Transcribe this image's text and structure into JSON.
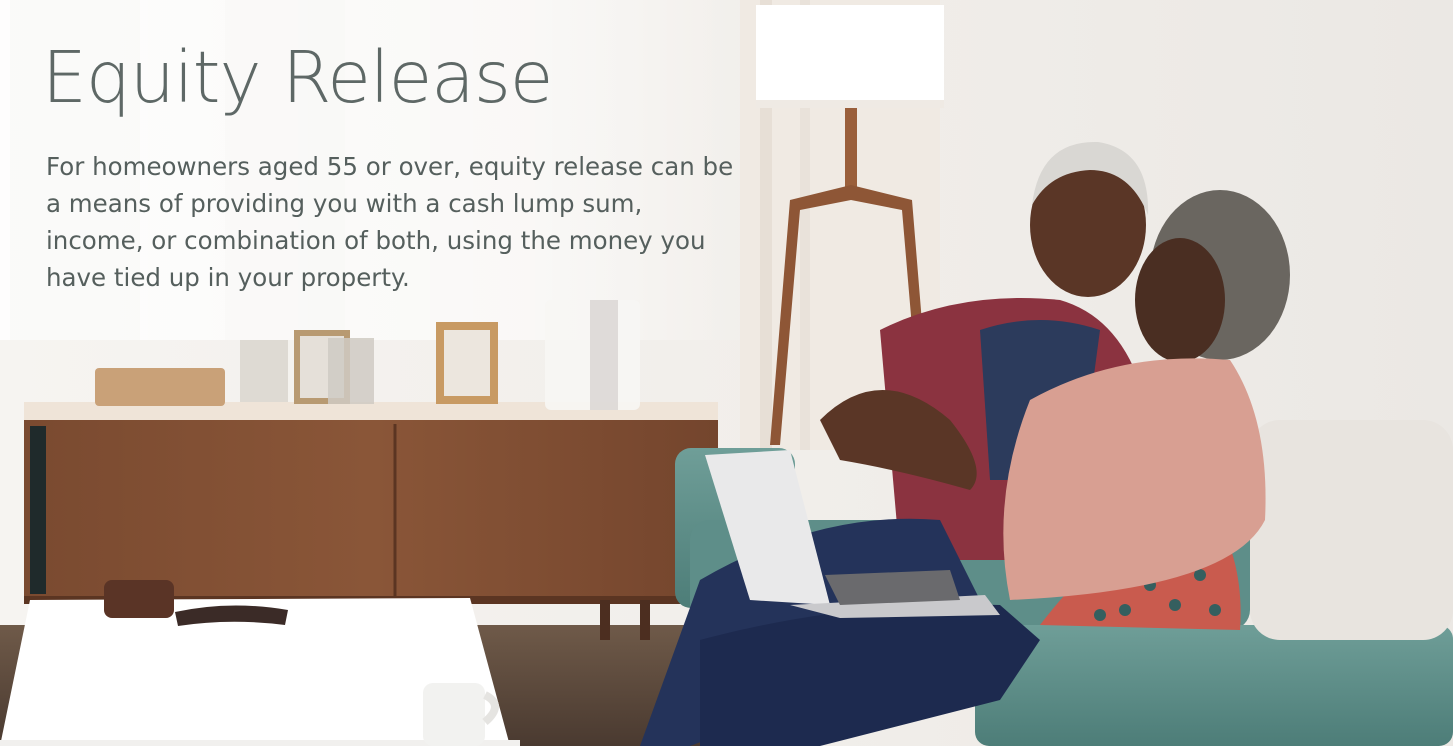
{
  "hero": {
    "title": "Equity Release",
    "description": "For homeowners aged 55 or over, equity release can be a means of providing you with a cash lump sum, income, or combination of both, using the money you have tied up in your property."
  },
  "image": {
    "subject": "older-couple-on-sofa-with-laptop"
  }
}
